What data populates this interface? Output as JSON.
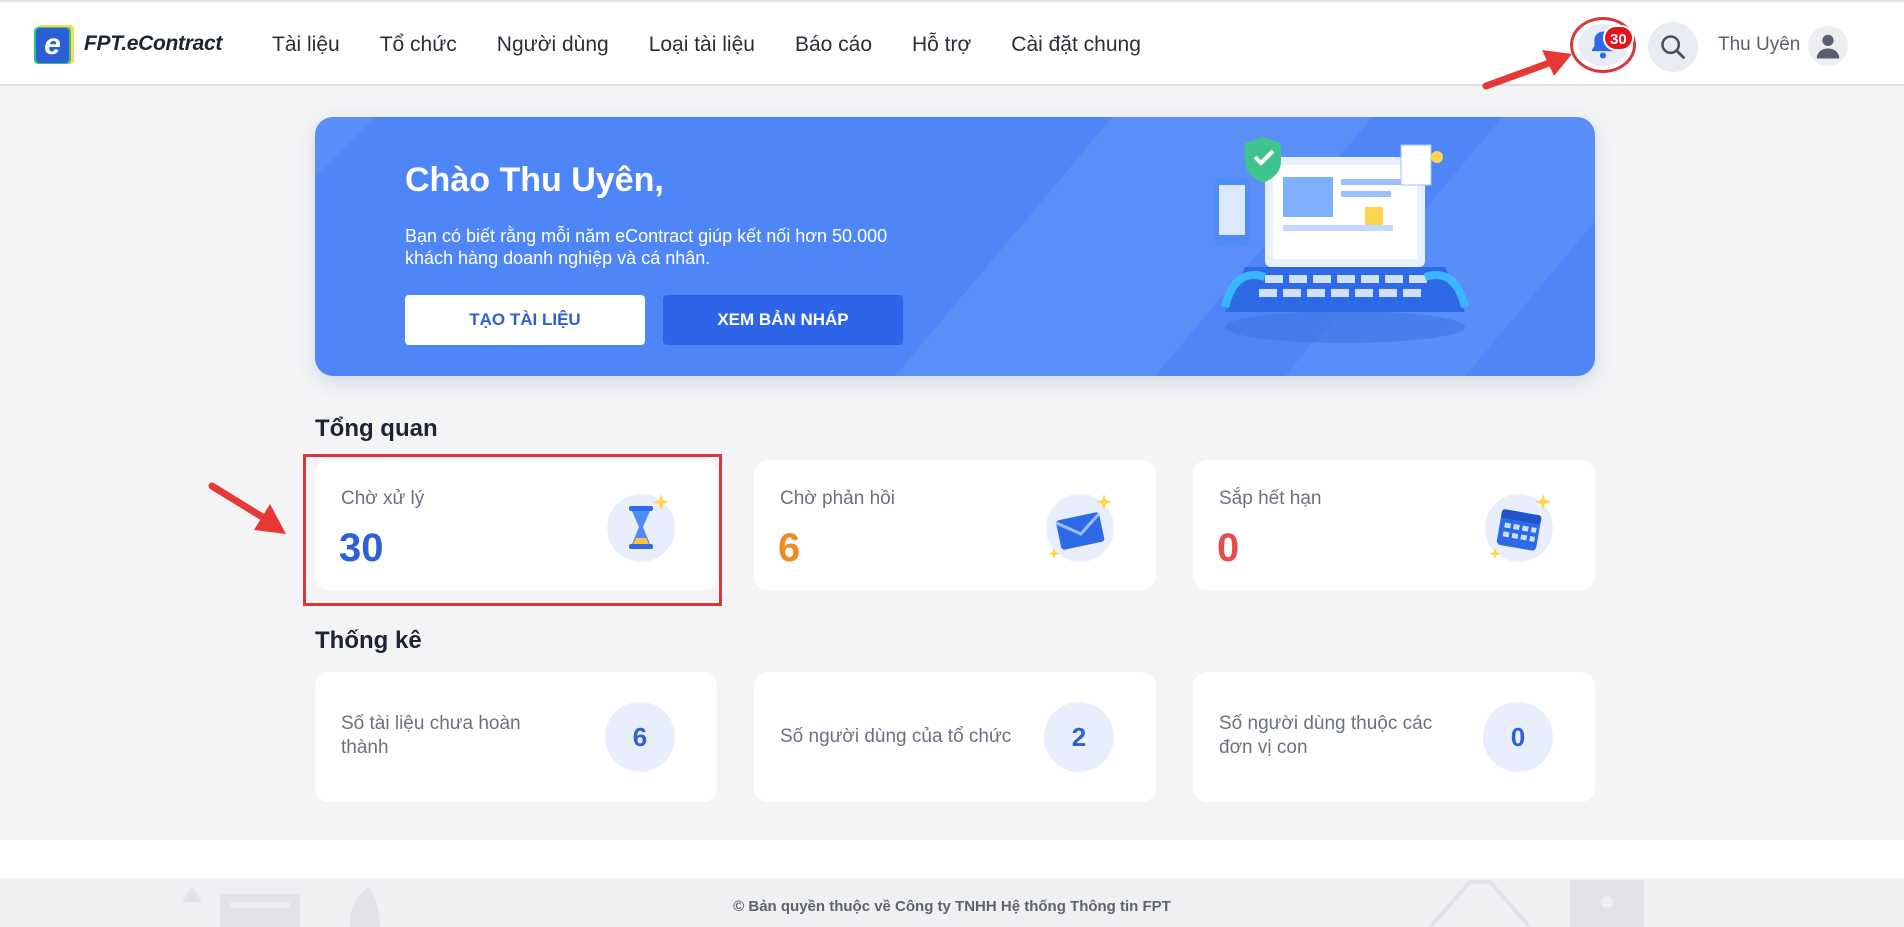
{
  "header": {
    "logo_text": "FPT.eContract",
    "logo_letter": "e",
    "nav": [
      "Tài liệu",
      "Tổ chức",
      "Người dùng",
      "Loại tài liệu",
      "Báo cáo",
      "Hỗ trợ",
      "Cài đặt chung"
    ],
    "notification_count": "30",
    "user_name": "Thu Uyên",
    "icons": {
      "notification": "bell-icon",
      "search": "search-icon",
      "avatar": "user-avatar-icon"
    }
  },
  "banner": {
    "greeting": "Chào Thu Uyên,",
    "description_line1": "Bạn có biết rằng mỗi năm eContract giúp kết nối hơn 50.000",
    "description_line2": "khách hàng doanh nghiệp và cá nhân.",
    "create_button": "TẠO TÀI LIỆU",
    "draft_button": "XEM BẢN NHÁP"
  },
  "overview": {
    "title": "Tổng quan",
    "cards": [
      {
        "label": "Chờ xử lý",
        "value": "30",
        "color": "#2d5fd8",
        "icon": "hourglass-icon"
      },
      {
        "label": "Chờ phản hồi",
        "value": "6",
        "color": "#f08a24",
        "icon": "envelope-icon"
      },
      {
        "label": "Sắp hết hạn",
        "value": "0",
        "color": "#e84b4b",
        "icon": "calendar-icon"
      }
    ]
  },
  "stats": {
    "title": "Thống kê",
    "cards": [
      {
        "label": "Số tài liệu chưa hoàn thành",
        "value": "6"
      },
      {
        "label": "Số người dùng của tổ chức",
        "value": "2"
      },
      {
        "label": "Số người dùng thuộc các đơn vị con",
        "value": "0"
      }
    ]
  },
  "footer": {
    "copyright": "© Bản quyền thuộc về Công ty TNHH Hệ thống Thông tin FPT"
  },
  "colors": {
    "accent": "#2d5fd8",
    "banner": "#4f86f7",
    "highlight_annotation": "#d9373b"
  }
}
